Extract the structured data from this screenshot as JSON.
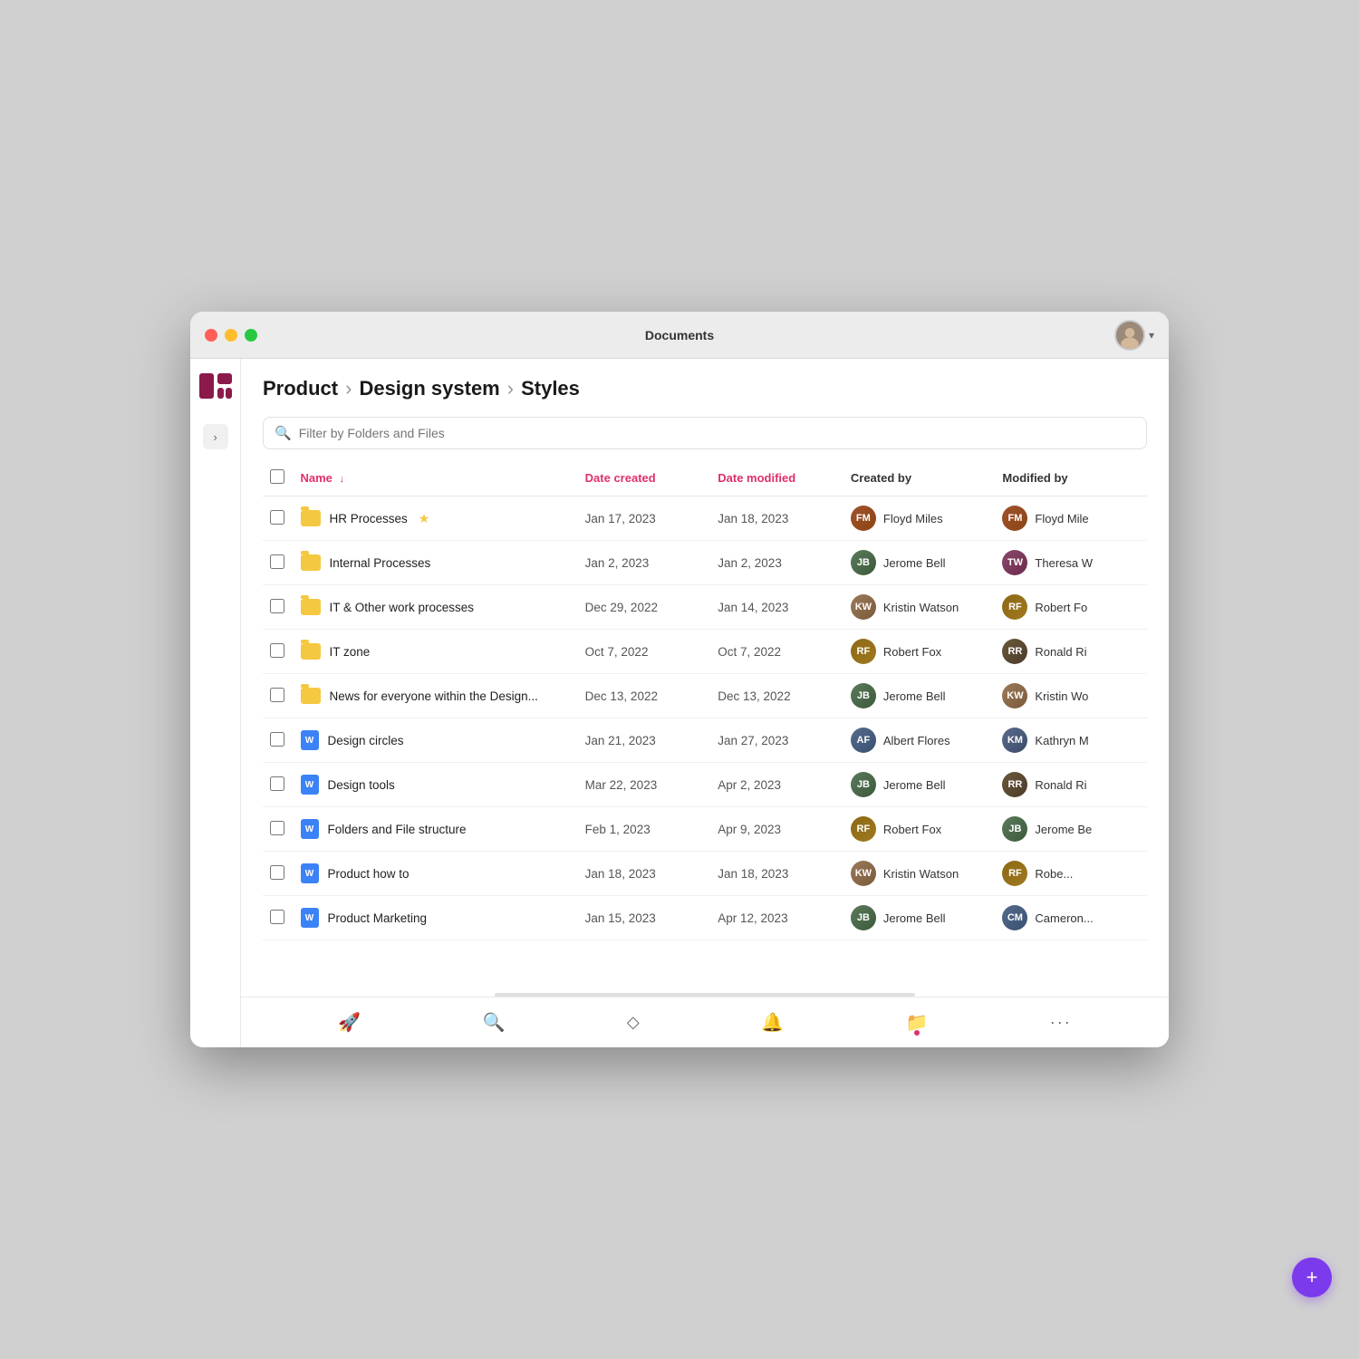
{
  "window": {
    "title": "Documents"
  },
  "breadcrumb": {
    "items": [
      "Product",
      "Design system",
      "Styles"
    ]
  },
  "search": {
    "placeholder": "Filter by Folders and Files"
  },
  "table": {
    "headers": {
      "name": "Name",
      "date_created": "Date created",
      "date_modified": "Date modified",
      "created_by": "Created by",
      "modified_by": "Modified by"
    },
    "rows": [
      {
        "id": 1,
        "type": "folder",
        "starred": true,
        "name": "HR Processes",
        "date_created": "Jan 17, 2023",
        "date_modified": "Jan 18, 2023",
        "created_by": "Floyd Miles",
        "created_by_initials": "FM",
        "created_by_color": "av-floyd",
        "modified_by": "Floyd Mile",
        "modified_by_initials": "FM",
        "modified_by_color": "av-floyd"
      },
      {
        "id": 2,
        "type": "folder",
        "starred": false,
        "name": "Internal Processes",
        "date_created": "Jan 2, 2023",
        "date_modified": "Jan 2, 2023",
        "created_by": "Jerome Bell",
        "created_by_initials": "JB",
        "created_by_color": "av-jerome",
        "modified_by": "Theresa W",
        "modified_by_initials": "TW",
        "modified_by_color": "av-theresa"
      },
      {
        "id": 3,
        "type": "folder",
        "starred": false,
        "name": "IT & Other work processes",
        "date_created": "Dec 29, 2022",
        "date_modified": "Jan 14, 2023",
        "created_by": "Kristin Watson",
        "created_by_initials": "KW",
        "created_by_color": "av-kristin",
        "modified_by": "Robert Fo",
        "modified_by_initials": "RF",
        "modified_by_color": "av-robert"
      },
      {
        "id": 4,
        "type": "folder",
        "starred": false,
        "name": "IT zone",
        "date_created": "Oct 7, 2022",
        "date_modified": "Oct 7, 2022",
        "created_by": "Robert Fox",
        "created_by_initials": "RF",
        "created_by_color": "av-robert",
        "modified_by": "Ronald Ri",
        "modified_by_initials": "RR",
        "modified_by_color": "av-ronald"
      },
      {
        "id": 5,
        "type": "folder",
        "starred": false,
        "name": "News for everyone within the Design...",
        "date_created": "Dec 13, 2022",
        "date_modified": "Dec 13, 2022",
        "created_by": "Jerome Bell",
        "created_by_initials": "JB",
        "created_by_color": "av-jerome",
        "modified_by": "Kristin Wo",
        "modified_by_initials": "KW",
        "modified_by_color": "av-kristin"
      },
      {
        "id": 6,
        "type": "doc",
        "starred": false,
        "name": "Design circles",
        "date_created": "Jan 21, 2023",
        "date_modified": "Jan 27, 2023",
        "created_by": "Albert Flores",
        "created_by_initials": "AF",
        "created_by_color": "av-albert",
        "modified_by": "Kathryn M",
        "modified_by_initials": "KM",
        "modified_by_color": "av-kathryn"
      },
      {
        "id": 7,
        "type": "doc",
        "starred": false,
        "name": "Design tools",
        "date_created": "Mar 22, 2023",
        "date_modified": "Apr 2, 2023",
        "created_by": "Jerome Bell",
        "created_by_initials": "JB",
        "created_by_color": "av-jerome",
        "modified_by": "Ronald Ri",
        "modified_by_initials": "RR",
        "modified_by_color": "av-ronald"
      },
      {
        "id": 8,
        "type": "doc",
        "starred": false,
        "name": "Folders and File structure",
        "date_created": "Feb 1, 2023",
        "date_modified": "Apr 9, 2023",
        "created_by": "Robert Fox",
        "created_by_initials": "RF",
        "created_by_color": "av-robert",
        "modified_by": "Jerome Be",
        "modified_by_initials": "JB",
        "modified_by_color": "av-jerome"
      },
      {
        "id": 9,
        "type": "doc",
        "starred": false,
        "name": "Product how to",
        "date_created": "Jan 18, 2023",
        "date_modified": "Jan 18, 2023",
        "created_by": "Kristin Watson",
        "created_by_initials": "KW",
        "created_by_color": "av-kristin",
        "modified_by": "Robe...",
        "modified_by_initials": "RF",
        "modified_by_color": "av-robert"
      },
      {
        "id": 10,
        "type": "doc",
        "starred": false,
        "name": "Product Marketing",
        "date_created": "Jan 15, 2023",
        "date_modified": "Apr 12, 2023",
        "created_by": "Jerome Bell",
        "created_by_initials": "JB",
        "created_by_color": "av-jerome",
        "modified_by": "Cameron...",
        "modified_by_initials": "CM",
        "modified_by_color": "av-albert"
      }
    ]
  },
  "bottom_nav": {
    "items": [
      {
        "icon": "🚀",
        "label": "launch",
        "active": false
      },
      {
        "icon": "🔍",
        "label": "search",
        "active": false
      },
      {
        "icon": "◇",
        "label": "share",
        "active": false
      },
      {
        "icon": "🔔",
        "label": "notifications",
        "active": false
      },
      {
        "icon": "📁",
        "label": "files",
        "active": true
      },
      {
        "icon": "···",
        "label": "more",
        "active": false
      }
    ]
  },
  "fab_label": "+",
  "sort_icon": "↓"
}
